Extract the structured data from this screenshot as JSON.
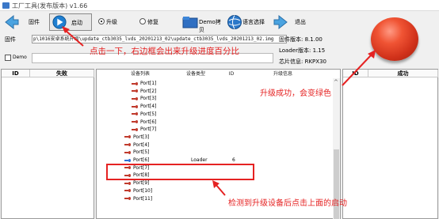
{
  "window": {
    "title": "工厂工具(发布版本) v1.66"
  },
  "toolbar": {
    "firmware_label": "固件",
    "start_label": "启动",
    "mode_options": [
      {
        "label": "升级",
        "selected": true
      },
      {
        "label": "修复",
        "selected": false
      }
    ],
    "demo_copy_label": "Demo拷贝",
    "language_label": "语言选择",
    "exit_label": "退出"
  },
  "firmware": {
    "label": "固件",
    "path": "p\\1016安卓系统升级\\update_ctb3035_lvds_20201213_02\\update_ctb3035_lvds_20201213_02.img",
    "version_label": "固件版本:",
    "version": "8.1.00",
    "loader_label": "Loader版本:",
    "loader_version": "1.15",
    "chip_label": "芯片信息:",
    "chip": "RKPX30"
  },
  "demo": {
    "label": "Demo",
    "checked": false,
    "value": ""
  },
  "fail_panel": {
    "col_id": "ID",
    "col_status": "失败"
  },
  "device_panel": {
    "col_list": "设备列表",
    "col_type": "设备类型",
    "col_id": "ID",
    "col_info": "升级信息",
    "ports": [
      {
        "name": "Port[1]",
        "type": "",
        "id": ""
      },
      {
        "name": "Port[2]",
        "type": "",
        "id": ""
      },
      {
        "name": "Port[3]",
        "type": "",
        "id": ""
      },
      {
        "name": "Port[4]",
        "type": "",
        "id": ""
      },
      {
        "name": "Port[5]",
        "type": "",
        "id": ""
      },
      {
        "name": "Port[6]",
        "type": "",
        "id": ""
      },
      {
        "name": "Port[7]",
        "type": "",
        "id": ""
      },
      {
        "name": "Port[3]",
        "type": "",
        "id": ""
      },
      {
        "name": "Port[4]",
        "type": "",
        "id": ""
      },
      {
        "name": "Port[5]",
        "type": "",
        "id": ""
      },
      {
        "name": "Port[6]",
        "type": "Loader",
        "id": "6",
        "active": true
      },
      {
        "name": "Port[7]",
        "type": "",
        "id": ""
      },
      {
        "name": "Port[8]",
        "type": "",
        "id": ""
      },
      {
        "name": "Port[9]",
        "type": "",
        "id": ""
      },
      {
        "name": "Port[10]",
        "type": "",
        "id": ""
      },
      {
        "name": "Port[11]",
        "type": "",
        "id": ""
      }
    ]
  },
  "success_panel": {
    "col_id": "ID",
    "col_status": "成功"
  },
  "annotations": {
    "click_hint": "点击一下，右边框会出来升级进度百分比",
    "success_hint": "升级成功，会变绿色",
    "detect_hint": "检测到升级设备后点击上面的启动"
  },
  "colors": {
    "annotation": "#e52222",
    "big_button": "#e8452a",
    "usb_icon": "#c0392b",
    "usb_icon_active": "#2b6fd6"
  }
}
